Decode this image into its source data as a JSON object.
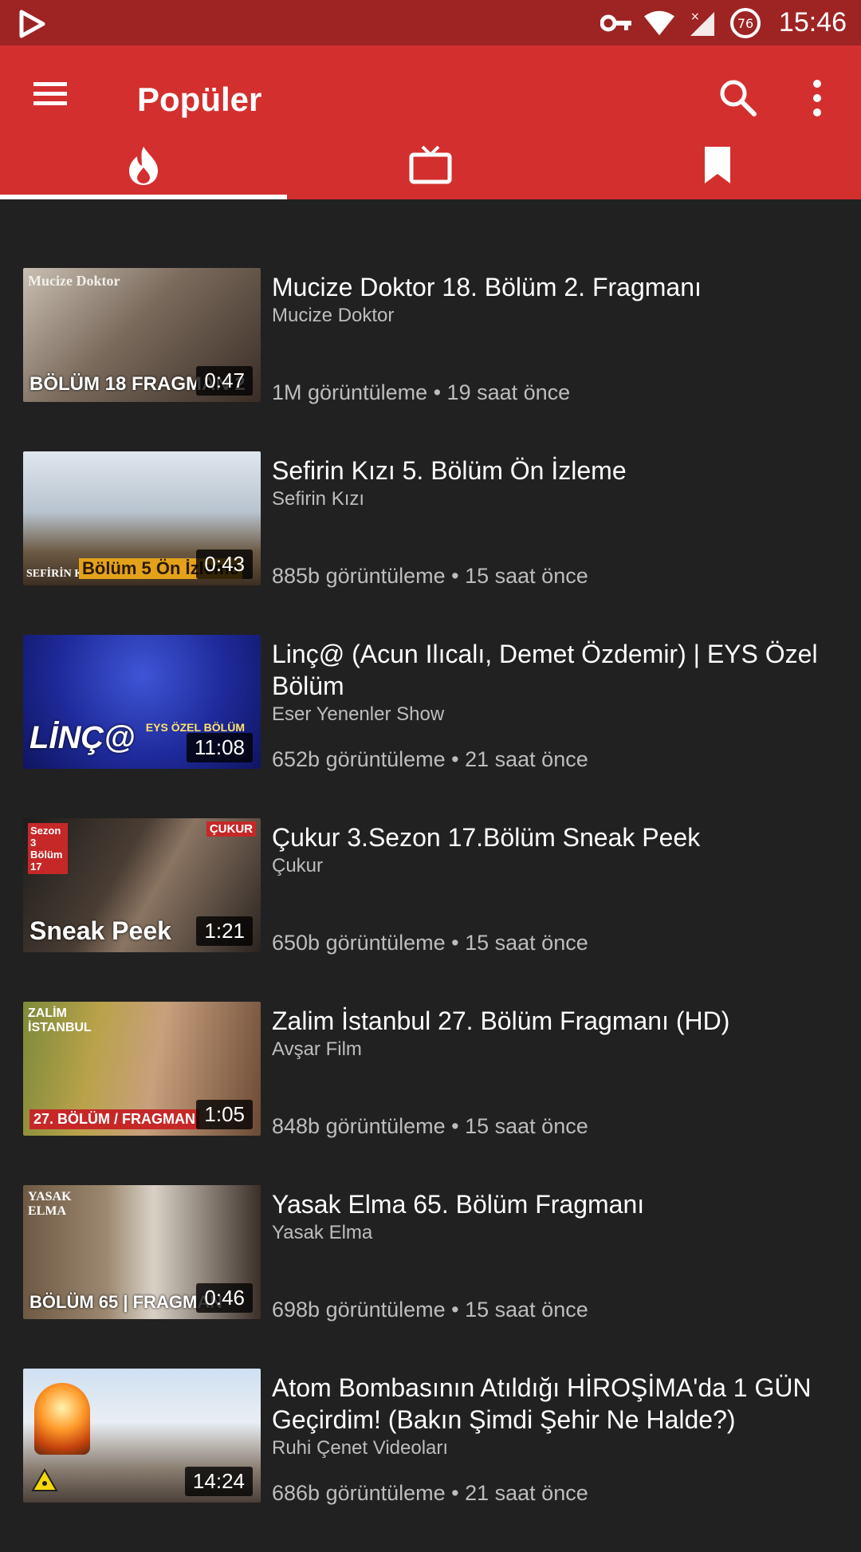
{
  "status_bar": {
    "time": "15:46",
    "battery_level": "76",
    "icons": [
      "play-store-icon",
      "vpn-key-icon",
      "wifi-icon",
      "signal-icon",
      "battery-icon"
    ]
  },
  "app_bar": {
    "title": "Popüler",
    "color": "#d32f2f",
    "status_color": "#9e2424"
  },
  "tabs": [
    {
      "name": "trending",
      "icon": "fire-icon",
      "active": true
    },
    {
      "name": "subscriptions",
      "icon": "tv-icon",
      "active": false
    },
    {
      "name": "saved",
      "icon": "bookmark-icon",
      "active": false
    }
  ],
  "videos": [
    {
      "title": "Mucize Doktor 18. Bölüm 2. Fragmanı",
      "channel": "Mucize Doktor",
      "stats": "1M görüntüleme • 19 saat önce",
      "duration": "0:47",
      "thumb_text": "BÖLÜM 18   FRAGMAN 2",
      "thumb_corner": "Mucize Doktor"
    },
    {
      "title": "Sefirin Kızı 5. Bölüm Ön İzleme",
      "channel": "Sefirin Kızı",
      "stats": "885b görüntüleme • 15 saat önce",
      "duration": "0:43",
      "thumb_text": "Bölüm 5 Ön İzleme",
      "thumb_corner": "SEFİRİN KIZI"
    },
    {
      "title": "Linç@ (Acun Ilıcalı, Demet Özdemir) | EYS Özel Bölüm",
      "channel": "Eser Yenenler Show",
      "stats": "652b görüntüleme • 21 saat önce",
      "duration": "11:08",
      "thumb_text": "LİNÇ@",
      "thumb_corner": "EYS ÖZEL BÖLÜM"
    },
    {
      "title": "Çukur 3.Sezon 17.Bölüm Sneak Peek",
      "channel": "Çukur",
      "stats": "650b görüntüleme • 15 saat önce",
      "duration": "1:21",
      "thumb_text": "Sneak Peek",
      "thumb_corner": "Sezon 3 Bölüm 17"
    },
    {
      "title": "Zalim İstanbul 27. Bölüm Fragmanı (HD)",
      "channel": "Avşar Film",
      "stats": "848b görüntüleme • 15 saat önce",
      "duration": "1:05",
      "thumb_text": "27. BÖLÜM / FRAGMAN",
      "thumb_corner": "ZALİM İSTANBUL"
    },
    {
      "title": "Yasak Elma 65. Bölüm Fragmanı",
      "channel": "Yasak Elma",
      "stats": "698b görüntüleme • 15 saat önce",
      "duration": "0:46",
      "thumb_text": "BÖLÜM 65 | FRAGMAN",
      "thumb_corner": "YASAK ELMA"
    },
    {
      "title": "Atom Bombasının Atıldığı HİROŞİMA'da 1 GÜN Geçirdim! (Bakın Şimdi Şehir Ne Halde?)",
      "channel": "Ruhi Çenet Videoları",
      "stats": "686b görüntüleme • 21 saat önce",
      "duration": "14:24",
      "thumb_text": "",
      "thumb_corner": ""
    }
  ]
}
